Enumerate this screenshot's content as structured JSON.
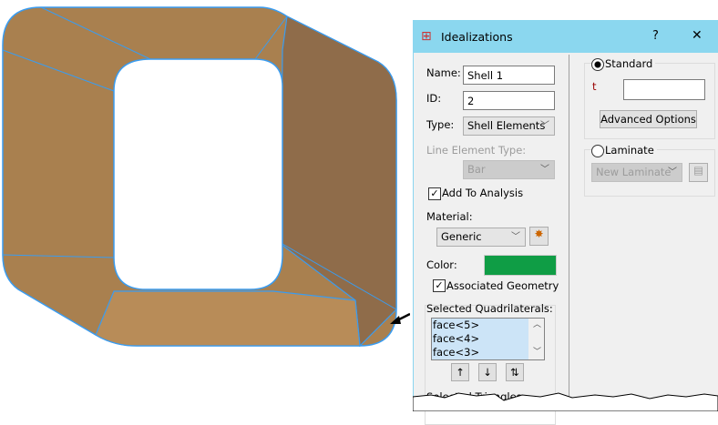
{
  "dialog": {
    "title": "Idealizations",
    "help": "?",
    "close": "✕"
  },
  "left": {
    "name_label": "Name:",
    "name_value": "Shell 1",
    "id_label": "ID:",
    "id_value": "2",
    "type_label": "Type:",
    "type_value": "Shell Elements",
    "line_type_label": "Line Element Type:",
    "line_type_value": "Bar",
    "add_to_analysis": "Add To Analysis",
    "material_label": "Material:",
    "material_value": "Generic",
    "color_label": "Color:",
    "color_value": "#0f9d45",
    "assoc_geometry": "Associated Geometry",
    "quads_label": "Selected Quadrilaterals:",
    "quads": [
      "face<5>",
      "face<4>",
      "face<3>"
    ],
    "tri_label": "Selected Triangles"
  },
  "right": {
    "standard": "Standard",
    "t_label": "t",
    "t_value": "",
    "advanced": "Advanced Options",
    "laminate": "Laminate",
    "laminate_value": "New Laminate"
  }
}
